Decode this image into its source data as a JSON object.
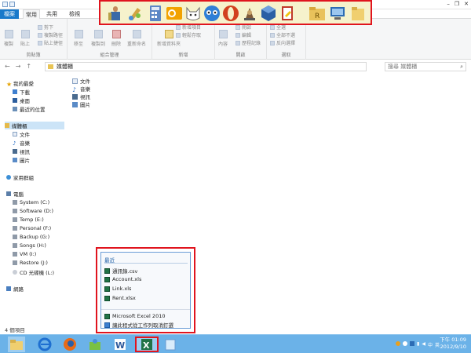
{
  "ribbon": {
    "tabs": [
      "檔案",
      "常用",
      "共用",
      "檢視"
    ],
    "groups": {
      "clipboard": {
        "label": "剪貼簿",
        "copy": "複製",
        "paste": "貼上",
        "cut": "剪下",
        "copy_path": "複製路徑",
        "paste_shortcut": "貼上捷徑"
      },
      "organize": {
        "label": "組合管理",
        "move_to": "移至",
        "copy_to": "複製到",
        "delete": "刪除",
        "rename": "重新命名"
      },
      "new": {
        "label": "新增",
        "new_folder": "新增資料夾",
        "new_item": "新增項目",
        "easy_access": "輕鬆存取"
      },
      "open": {
        "label": "開啟",
        "properties": "內容",
        "open": "開啟",
        "edit": "編輯",
        "history": "歷程記錄"
      },
      "select": {
        "label": "選取",
        "select_all": "全選",
        "select_none": "全部不選",
        "invert": "反向選擇"
      }
    }
  },
  "address": {
    "path": "媒體櫃",
    "search_placeholder": "搜尋 媒體櫃"
  },
  "navpane": {
    "favorites": "我的最愛",
    "fav_items": [
      "下載",
      "桌面",
      "最近的位置"
    ],
    "libraries": "媒體櫃",
    "lib_items": [
      "文件",
      "音樂",
      "視訊",
      "圖片"
    ],
    "homegroup": "家用群組",
    "computer": "電腦",
    "drives": [
      "System (C:)",
      "Software (D:)",
      "Temp (E:)",
      "Personal (F:)",
      "Backup (G:)",
      "Songs (H:)",
      "VM (I:)",
      "Restore (J:)",
      "CD 光碟機 (L:)"
    ],
    "network": "網路"
  },
  "content_items": [
    "文件",
    "音樂",
    "視訊",
    "圖片"
  ],
  "status": {
    "item_count": "4 個項目"
  },
  "jumplist": {
    "header": "最近",
    "recent": [
      "通訊錄.csv",
      "Account.xls",
      "Link.xls",
      "Rent.xlsx"
    ],
    "app": "Microsoft Excel 2010",
    "unpin": "讓此程式從工作列取消釘選"
  },
  "clock": {
    "time": "下午 01:09",
    "date": "2012/9/10"
  },
  "tray": {
    "ime": "中",
    "lang": "英"
  },
  "colors": {
    "highlight": "#e0141e",
    "taskbar": "#6bb2e8",
    "file_tab": "#1979ca"
  }
}
